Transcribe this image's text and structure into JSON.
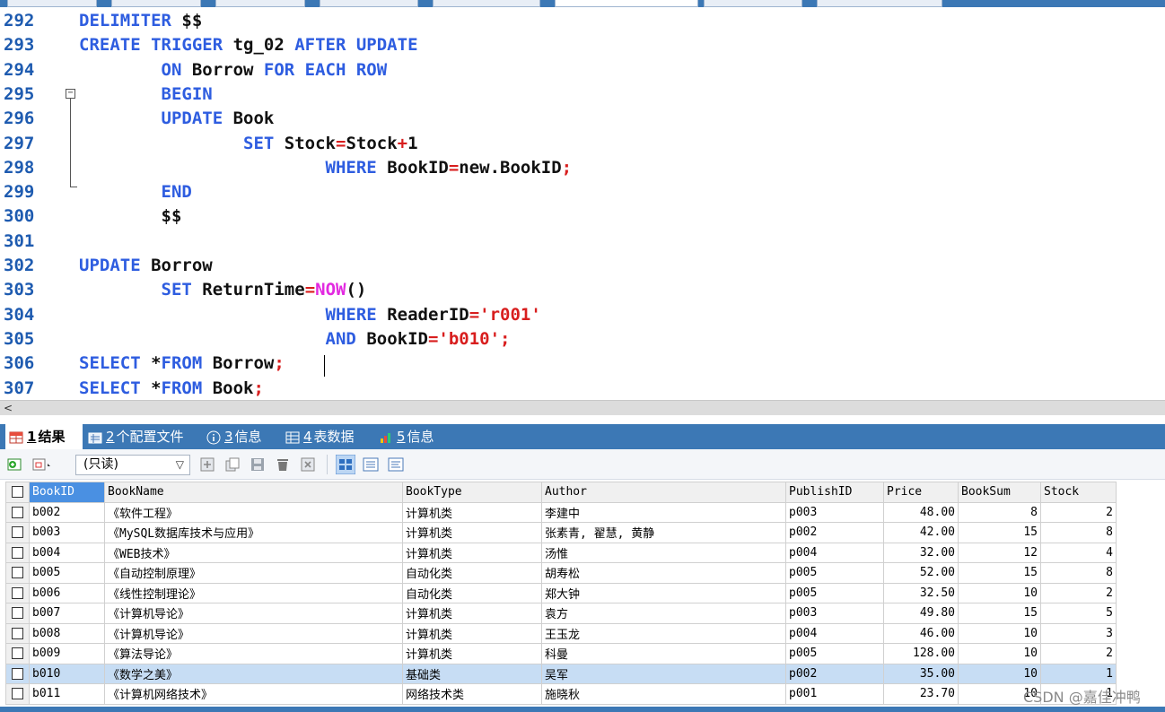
{
  "editor": {
    "lines": [
      {
        "num": "292",
        "tokens": [
          [
            "kw",
            "DELIMITER"
          ],
          [
            "t",
            " $$"
          ]
        ]
      },
      {
        "num": "293",
        "tokens": [
          [
            "kw",
            "CREATE TRIGGER"
          ],
          [
            "t",
            " tg_02 "
          ],
          [
            "kw",
            "AFTER UPDATE"
          ]
        ]
      },
      {
        "num": "294",
        "tokens": [
          [
            "t",
            "        "
          ],
          [
            "kw",
            "ON"
          ],
          [
            "t",
            " Borrow "
          ],
          [
            "kw",
            "FOR EACH ROW"
          ]
        ]
      },
      {
        "num": "295",
        "tokens": [
          [
            "t",
            "        "
          ],
          [
            "kw",
            "BEGIN"
          ]
        ]
      },
      {
        "num": "296",
        "tokens": [
          [
            "t",
            "        "
          ],
          [
            "kw",
            "UPDATE"
          ],
          [
            "t",
            " Book"
          ]
        ]
      },
      {
        "num": "297",
        "tokens": [
          [
            "t",
            "                "
          ],
          [
            "kw",
            "SET"
          ],
          [
            "t",
            " Stock"
          ],
          [
            "op",
            "="
          ],
          [
            "t",
            "Stock"
          ],
          [
            "op",
            "+"
          ],
          [
            "t",
            "1"
          ]
        ]
      },
      {
        "num": "298",
        "tokens": [
          [
            "t",
            "                        "
          ],
          [
            "kw",
            "WHERE"
          ],
          [
            "t",
            " BookID"
          ],
          [
            "op",
            "="
          ],
          [
            "t",
            "new.BookID"
          ],
          [
            "op",
            ";"
          ]
        ]
      },
      {
        "num": "299",
        "tokens": [
          [
            "t",
            "        "
          ],
          [
            "kw",
            "END"
          ]
        ]
      },
      {
        "num": "300",
        "tokens": [
          [
            "t",
            "        $$"
          ]
        ]
      },
      {
        "num": "301",
        "tokens": []
      },
      {
        "num": "302",
        "tokens": [
          [
            "kw",
            "UPDATE"
          ],
          [
            "t",
            " Borrow"
          ]
        ]
      },
      {
        "num": "303",
        "tokens": [
          [
            "t",
            "        "
          ],
          [
            "kw",
            "SET"
          ],
          [
            "t",
            " ReturnTime"
          ],
          [
            "op",
            "="
          ],
          [
            "fn",
            "NOW"
          ],
          [
            "t",
            "()"
          ]
        ]
      },
      {
        "num": "304",
        "tokens": [
          [
            "t",
            "                        "
          ],
          [
            "kw",
            "WHERE"
          ],
          [
            "t",
            " ReaderID"
          ],
          [
            "op",
            "="
          ],
          [
            "str",
            "'r001'"
          ]
        ]
      },
      {
        "num": "305",
        "tokens": [
          [
            "t",
            "                        "
          ],
          [
            "kw",
            "AND"
          ],
          [
            "t",
            " BookID"
          ],
          [
            "op",
            "="
          ],
          [
            "str",
            "'b010'"
          ],
          [
            "op",
            ";"
          ]
        ]
      },
      {
        "num": "306",
        "tokens": [
          [
            "kw",
            "SELECT"
          ],
          [
            "t",
            " *"
          ],
          [
            "kw",
            "FROM"
          ],
          [
            "t",
            " Borrow"
          ],
          [
            "op",
            ";"
          ]
        ]
      },
      {
        "num": "307",
        "tokens": [
          [
            "kw",
            "SELECT"
          ],
          [
            "t",
            " *"
          ],
          [
            "kw",
            "FROM"
          ],
          [
            "t",
            " Book"
          ],
          [
            "op",
            ";"
          ]
        ]
      }
    ]
  },
  "scrollbar": {
    "left_arrow": "<"
  },
  "result_tabs": [
    {
      "num": "1",
      "label": "结果",
      "icon": "grid-icon",
      "active": true
    },
    {
      "num": "2",
      "label": "个配置文件",
      "icon": "profile-icon",
      "active": false
    },
    {
      "num": "3",
      "label": "信息",
      "icon": "info-icon",
      "active": false
    },
    {
      "num": "4",
      "label": "表数据",
      "icon": "table-icon",
      "active": false
    },
    {
      "num": "5",
      "label": "信息",
      "icon": "chart-icon",
      "active": false
    }
  ],
  "toolbar": {
    "readonly_value": "(只读)"
  },
  "grid": {
    "columns": [
      "BookID",
      "BookName",
      "BookType",
      "Author",
      "PublishID",
      "Price",
      "BookSum",
      "Stock"
    ],
    "rows": [
      [
        "b002",
        "《软件工程》",
        "计算机类",
        "李建中",
        "p003",
        "48.00",
        "8",
        "2"
      ],
      [
        "b003",
        "《MySQL数据库技术与应用》",
        "计算机类",
        "张素青, 翟慧, 黄静",
        "p002",
        "42.00",
        "15",
        "8"
      ],
      [
        "b004",
        "《WEB技术》",
        "计算机类",
        "汤惟",
        "p004",
        "32.00",
        "12",
        "4"
      ],
      [
        "b005",
        "《自动控制原理》",
        "自动化类",
        "胡寿松",
        "p005",
        "52.00",
        "15",
        "8"
      ],
      [
        "b006",
        "《线性控制理论》",
        "自动化类",
        "郑大钟",
        "p005",
        "32.50",
        "10",
        "2"
      ],
      [
        "b007",
        "《计算机导论》",
        "计算机类",
        "袁方",
        "p003",
        "49.80",
        "15",
        "5"
      ],
      [
        "b008",
        "《计算机导论》",
        "计算机类",
        "王玉龙",
        "p004",
        "46.00",
        "10",
        "3"
      ],
      [
        "b009",
        "《算法导论》",
        "计算机类",
        "科曼",
        "p005",
        "128.00",
        "10",
        "2"
      ],
      [
        "b010",
        "《数学之美》",
        "基础类",
        "吴军",
        "p002",
        "35.00",
        "10",
        "1"
      ],
      [
        "b011",
        "《计算机网络技术》",
        "网络技术类",
        "施晓秋",
        "p001",
        "23.70",
        "10",
        "1"
      ]
    ],
    "selected_row": 8
  },
  "watermark": "CSDN @嘉佳冲鸭",
  "colors": {
    "accent": "#3c78b5",
    "keyword": "#2e5de0",
    "string": "#d81e1e",
    "function": "#e229e0",
    "selected_row": "#c7ddf4"
  }
}
